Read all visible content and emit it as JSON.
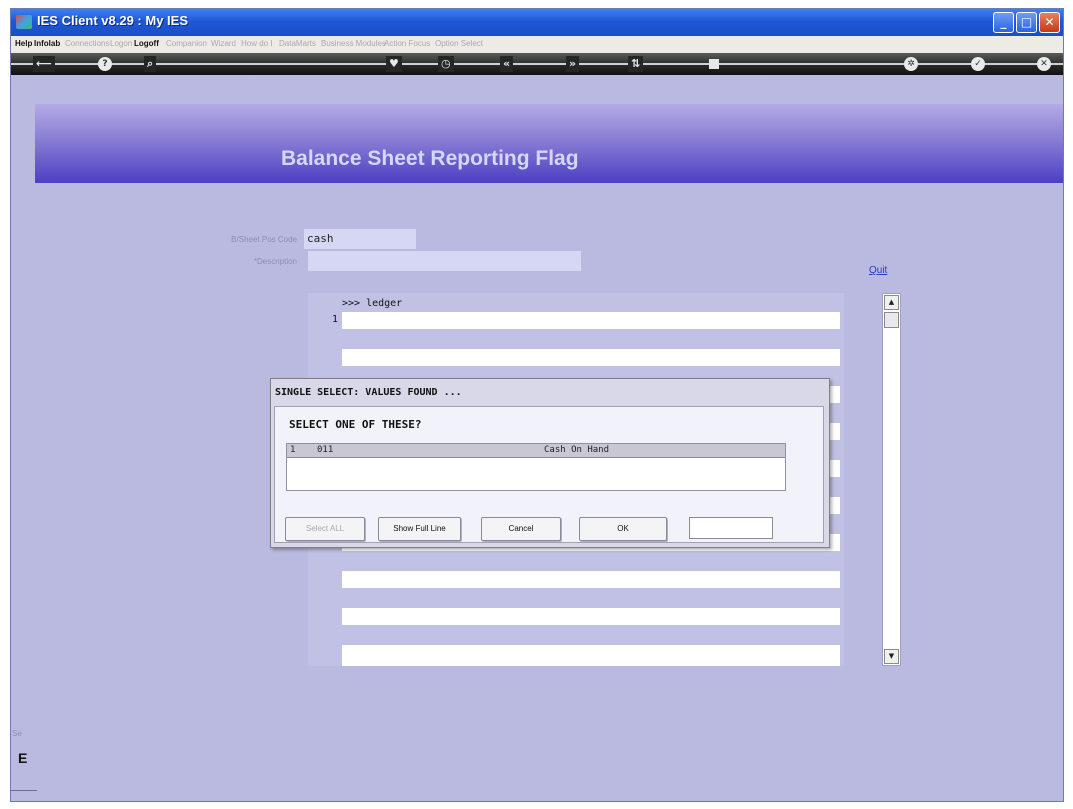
{
  "window": {
    "title": "IES Client v8.29 : My IES"
  },
  "menu": {
    "items": [
      "Help",
      "Infolab",
      "Connections",
      "Logon",
      "Logoff",
      "Companion",
      "Wizard",
      "How do I",
      "DataMarts",
      "Business Modules",
      "Action Focus",
      "Option Select"
    ]
  },
  "toolbar": {
    "back_icon": "⟵",
    "help_icon": "?",
    "search_icon": "⌕",
    "heart_icon": "♥",
    "clock_icon": "◷",
    "rewind_icon": "«",
    "forward_icon": "»",
    "sync_icon": "⇅",
    "ok_icon": "✓",
    "close_icon": "✕"
  },
  "banner": {
    "title": "Balance Sheet Reporting Flag"
  },
  "form": {
    "bsheet_pos_code": {
      "label": "B/Sheet Pos Code",
      "value": "cash"
    },
    "description": {
      "label": "*Description",
      "value": ""
    },
    "quit_label": "Quit"
  },
  "grid": {
    "header": ">>> ledger",
    "row_number": "1"
  },
  "dialog": {
    "title": "SINGLE SELECT: VALUES FOUND ...",
    "prompt": "SELECT ONE OF THESE?",
    "items": [
      {
        "index": "1",
        "code": "011",
        "name": "Cash On Hand"
      }
    ],
    "buttons": {
      "select_all": "Select ALL",
      "show_full_line": "Show Full Line",
      "cancel": "Cancel",
      "ok": "OK"
    },
    "input_value": ""
  },
  "side": {
    "label1": "Se",
    "label2": "E"
  },
  "colors": {
    "background": "#bab9e0",
    "banner": "#5c50c8",
    "titlebar": "#1f58d6"
  }
}
